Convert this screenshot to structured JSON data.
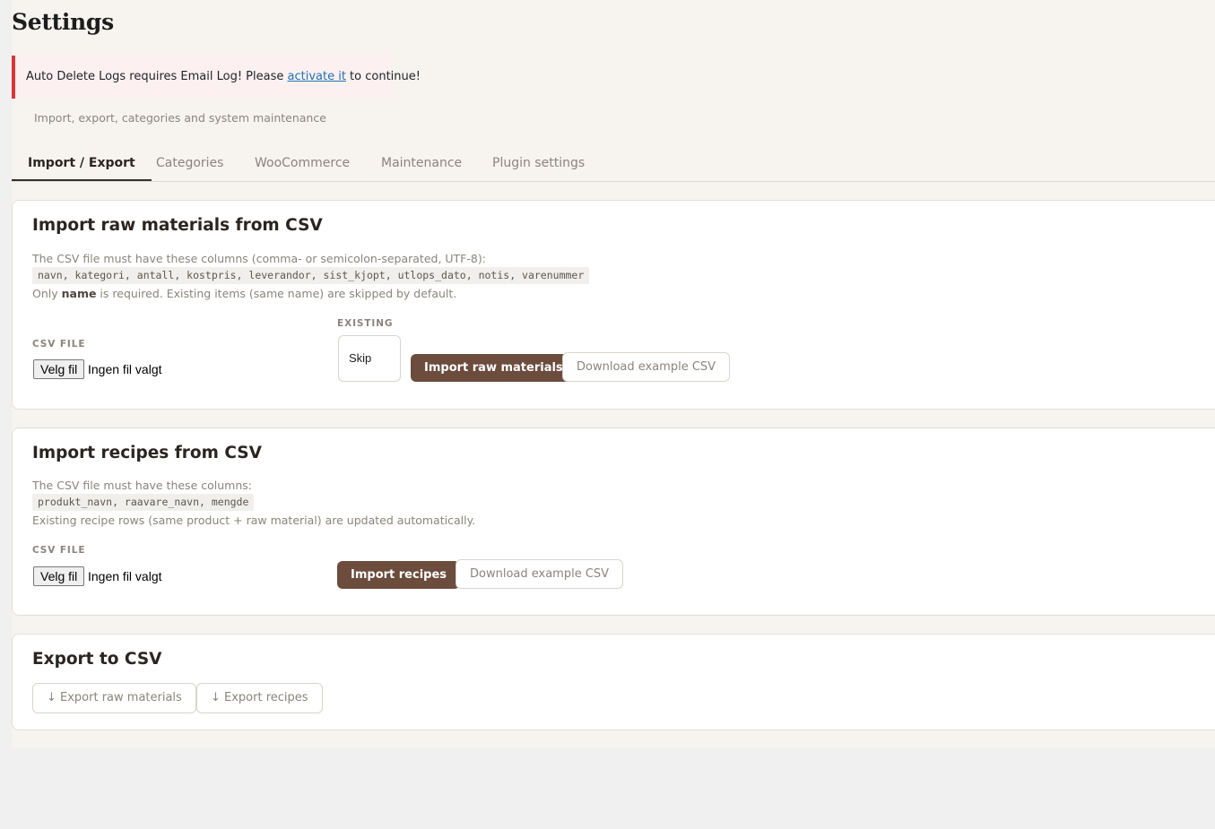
{
  "page": {
    "title": "Settings",
    "subtitle": "Import, export, categories and system maintenance"
  },
  "notice": {
    "text_before": "Auto Delete Logs requires Email Log! Please ",
    "link": "activate it",
    "text_after": " to continue!"
  },
  "tabs": [
    {
      "label": "Import / Export",
      "active": true
    },
    {
      "label": "Categories",
      "active": false
    },
    {
      "label": "WooCommerce",
      "active": false
    },
    {
      "label": "Maintenance",
      "active": false
    },
    {
      "label": "Plugin settings",
      "active": false
    }
  ],
  "raw_import": {
    "heading": "Import raw materials from CSV",
    "desc": "The CSV file must have these columns (comma- or semicolon-separated, UTF-8):",
    "columns": "navn, kategori, antall, kostpris, leverandor, sist_kjopt, utlops_dato, notis, varenummer",
    "note_prefix": "Only ",
    "note_bold": "name",
    "note_suffix": " is required. Existing items (same name) are skipped by default.",
    "file_label": "CSV FILE",
    "file_button": "Velg fil",
    "file_status": "Ingen fil valgt",
    "existing_label": "EXISTING",
    "existing_value": "Skip",
    "import_button": "Import raw materials",
    "example_button": "Download example CSV"
  },
  "recipe_import": {
    "heading": "Import recipes from CSV",
    "desc": "The CSV file must have these columns:",
    "columns": "produkt_navn, raavare_navn, mengde",
    "note": "Existing recipe rows (same product + raw material) are updated automatically.",
    "file_label": "CSV FILE",
    "file_button": "Velg fil",
    "file_status": "Ingen fil valgt",
    "import_button": "Import recipes",
    "example_button": "Download example CSV"
  },
  "export": {
    "heading": "Export to CSV",
    "raw_button": "↓ Export raw materials",
    "recipes_button": "↓ Export recipes"
  },
  "colors": {
    "accent": "#6b4c3d",
    "notice_border": "#d63638",
    "link": "#2271b1",
    "page_bg": "#f7f4f0"
  }
}
